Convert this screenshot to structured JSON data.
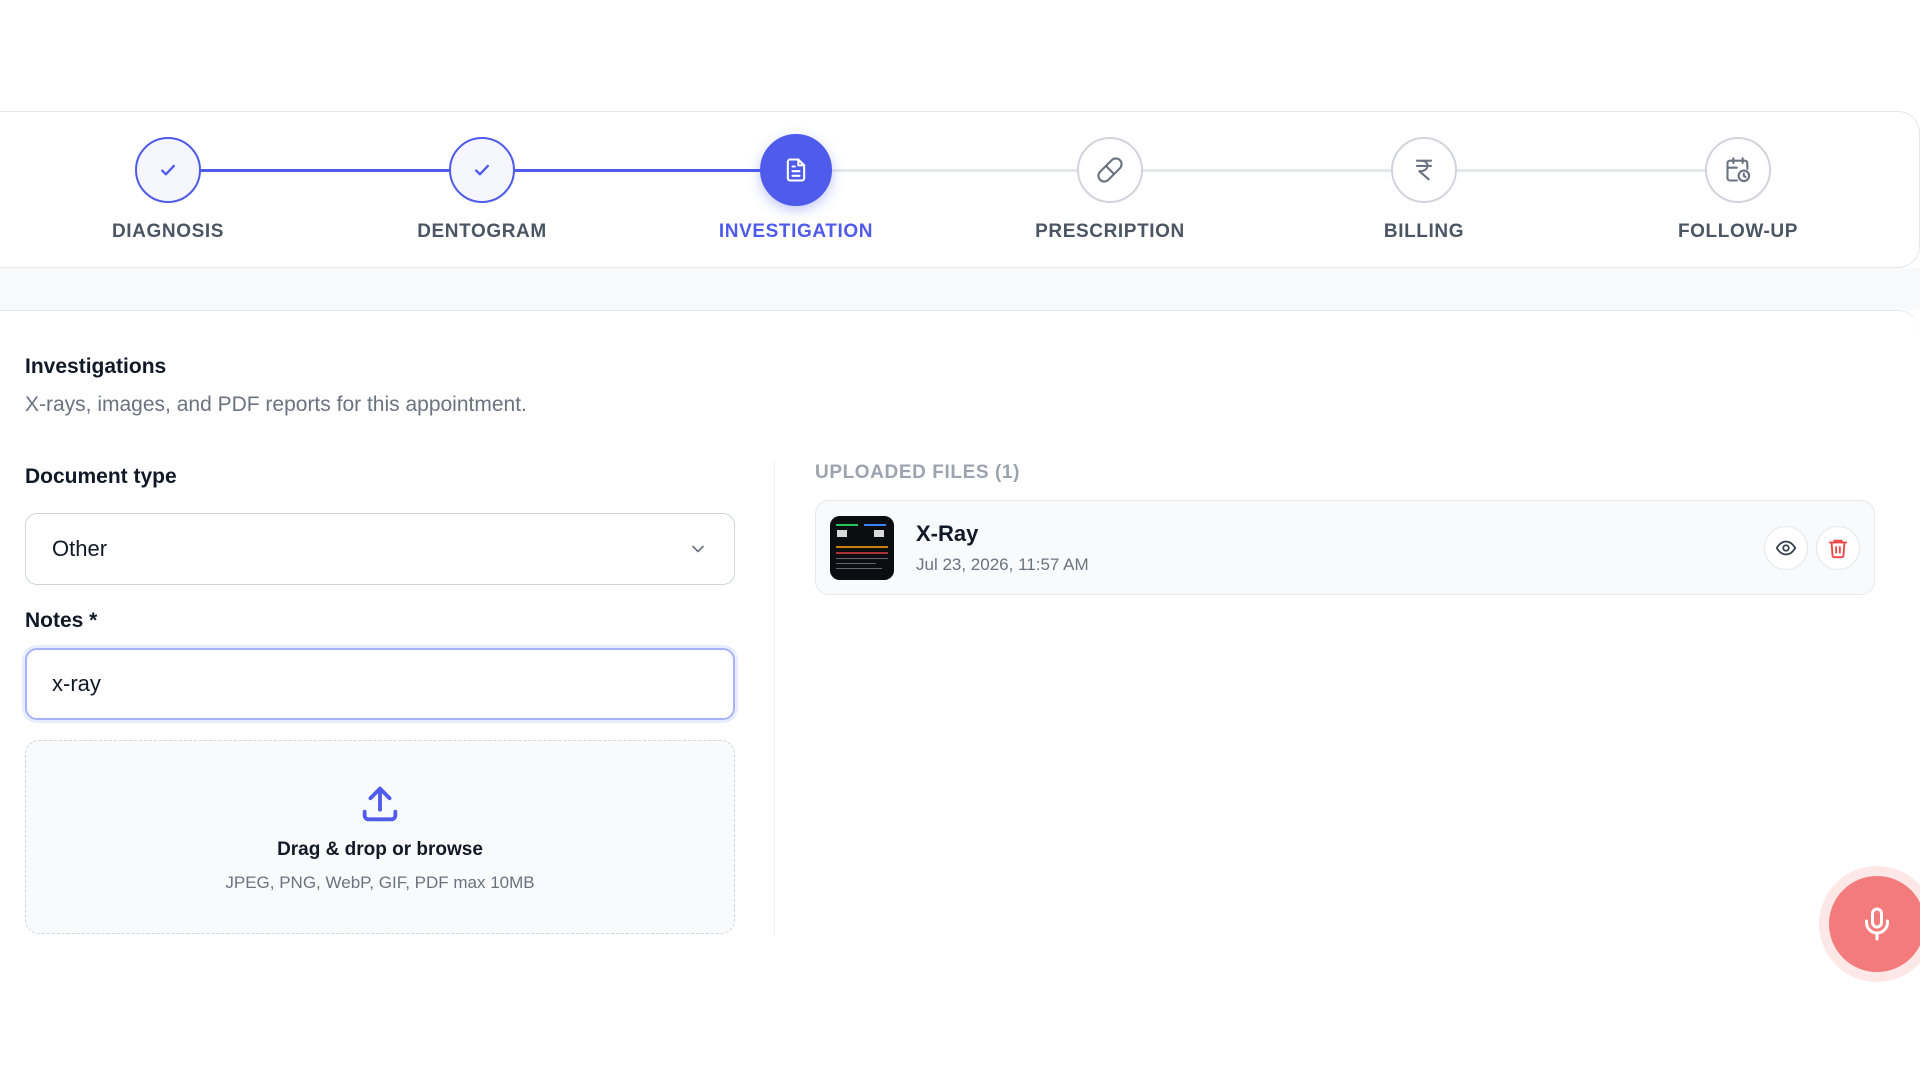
{
  "stepper": {
    "steps": [
      {
        "label": "DIAGNOSIS",
        "state": "done",
        "icon": "check-icon"
      },
      {
        "label": "DENTOGRAM",
        "state": "done",
        "icon": "check-icon"
      },
      {
        "label": "INVESTIGATION",
        "state": "active",
        "icon": "document-icon"
      },
      {
        "label": "PRESCRIPTION",
        "state": "pending",
        "icon": "pill-icon"
      },
      {
        "label": "BILLING",
        "state": "pending",
        "icon": "rupee-icon"
      },
      {
        "label": "FOLLOW-UP",
        "state": "pending",
        "icon": "calendar-clock-icon"
      }
    ]
  },
  "investigations": {
    "title": "Investigations",
    "subtitle": "X-rays, images, and PDF reports for this appointment."
  },
  "form": {
    "document_type_label": "Document type",
    "document_type_value": "Other",
    "notes_label": "Notes *",
    "notes_value": "x-ray"
  },
  "dropzone": {
    "title": "Drag & drop or browse",
    "hint": "JPEG, PNG, WebP, GIF, PDF max 10MB"
  },
  "uploaded": {
    "heading": "UPLOADED FILES (1)",
    "files": [
      {
        "name": "X-Ray",
        "date": "Jul 23, 2026, 11:57 AM"
      }
    ]
  },
  "colors": {
    "accent": "#4f5bea",
    "delete": "#ef4444",
    "mic": "#f47b7b"
  }
}
